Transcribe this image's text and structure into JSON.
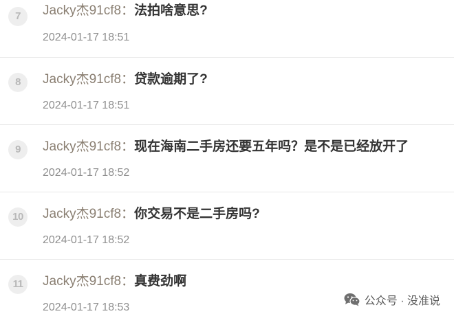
{
  "comments": [
    {
      "index": "7",
      "user": "Jacky杰91cf8",
      "sep": "：",
      "text": "法拍啥意思?",
      "time": "2024-01-17 18:51"
    },
    {
      "index": "8",
      "user": "Jacky杰91cf8",
      "sep": "：",
      "text": "贷款逾期了?",
      "time": "2024-01-17 18:51"
    },
    {
      "index": "9",
      "user": "Jacky杰91cf8",
      "sep": "：",
      "text": "现在海南二手房还要五年吗？是不是已经放开了",
      "time": "2024-01-17 18:52"
    },
    {
      "index": "10",
      "user": "Jacky杰91cf8",
      "sep": "：",
      "text": "你交易不是二手房吗?",
      "time": "2024-01-17 18:52"
    },
    {
      "index": "11",
      "user": "Jacky杰91cf8",
      "sep": "：",
      "text": "真费劲啊",
      "time": "2024-01-17 18:53"
    }
  ],
  "watermark": {
    "text": "公众号 · 没准说",
    "icon": "wechat-icon"
  }
}
